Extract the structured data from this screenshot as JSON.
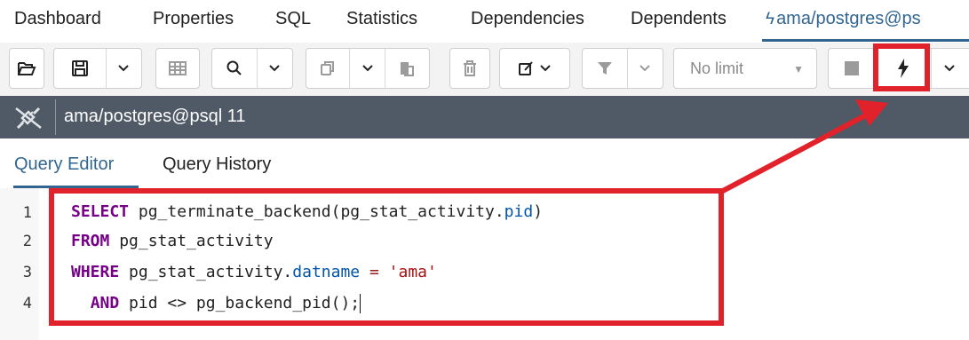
{
  "tabs": {
    "dashboard": "Dashboard",
    "properties": "Properties",
    "sql": "SQL",
    "statistics": "Statistics",
    "dependencies": "Dependencies",
    "dependents": "Dependents",
    "query_tool": "ama/postgres@ps"
  },
  "toolbar": {
    "open_icon": "folder-open-icon",
    "save_icon": "save-icon",
    "save_menu_icon": "chevron-down-icon",
    "view_data_icon": "grid-icon",
    "find_icon": "search-icon",
    "find_menu_icon": "chevron-down-icon",
    "copy_icon": "copy-icon",
    "copy_menu_icon": "chevron-down-icon",
    "paste_icon": "paste-icon",
    "delete_icon": "trash-icon",
    "edit_icon": "edit-icon",
    "filter_icon": "filter-icon",
    "filter_menu_icon": "chevron-down-icon",
    "limit_value": "No limit",
    "stop_icon": "stop-icon",
    "execute_icon": "lightning-icon",
    "execute_menu_icon": "chevron-down-icon"
  },
  "connection": {
    "label": "ama/postgres@psql 11"
  },
  "editor_tabs": {
    "query_editor": "Query Editor",
    "query_history": "Query History"
  },
  "code": {
    "line_numbers": [
      "1",
      "2",
      "3",
      "4"
    ],
    "l1": {
      "kw": "SELECT",
      "a": " pg_terminate_backend(pg_stat_activity.",
      "prop": "pid",
      "b": ")"
    },
    "l2": {
      "kw": "FROM",
      "a": " pg_stat_activity"
    },
    "l3": {
      "kw": "WHERE",
      "a": " pg_stat_activity.",
      "prop": "datname",
      "b": " ",
      "op": "=",
      "c": " ",
      "str": "'ama'"
    },
    "l4": {
      "indent": "  ",
      "kw": "AND",
      "a": " pid <> pg_backend_pid();"
    }
  },
  "colors": {
    "accent": "#326690",
    "annotation": "#e1222a",
    "connection_bar": "#4f5a66"
  }
}
